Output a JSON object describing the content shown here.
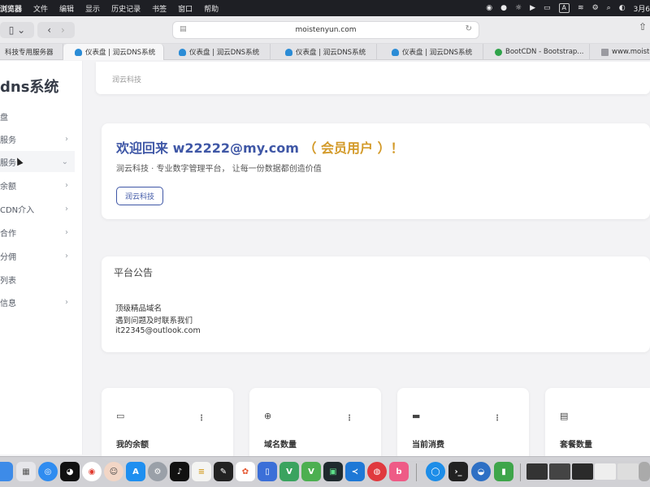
{
  "menubar": {
    "app": "浏览器",
    "items": [
      "文件",
      "编辑",
      "显示",
      "历史记录",
      "书签",
      "窗口",
      "帮助"
    ],
    "input_indicator": "A",
    "date": "3月6"
  },
  "toolbar": {
    "url": "moistenyun.com"
  },
  "tabs": [
    {
      "label": "科技专用服务器",
      "icon": "page-icon",
      "active": false
    },
    {
      "label": "仪表盘 | 润云DNS系统",
      "icon": "cloud-icon",
      "active": true
    },
    {
      "label": "仪表盘 | 润云DNS系统",
      "icon": "cloud-icon",
      "active": false
    },
    {
      "label": "仪表盘 | 润云DNS系统",
      "icon": "cloud-icon",
      "active": false
    },
    {
      "label": "仪表盘 | 润云DNS系统",
      "icon": "cloud-icon",
      "active": false
    },
    {
      "label": "BootCDN - Bootstrap...",
      "icon": "bootcdn-icon",
      "active": false
    },
    {
      "label": "www.moiste",
      "icon": "page-icon",
      "active": false
    }
  ],
  "sidebar": {
    "brand": "dns系统",
    "items": [
      {
        "label": "盘",
        "chevron": ""
      },
      {
        "label": "服务",
        "chevron": "›"
      },
      {
        "label": "服务",
        "chevron": "⌄"
      },
      {
        "label": "余额",
        "chevron": "›"
      },
      {
        "label": "CDN介入",
        "chevron": "›"
      },
      {
        "label": "合作",
        "chevron": "›"
      },
      {
        "label": "分佣",
        "chevron": "›"
      },
      {
        "label": "列表",
        "chevron": ""
      },
      {
        "label": "信息",
        "chevron": "›"
      }
    ]
  },
  "breadcrumb": "润云科技",
  "welcome": {
    "greeting": "欢迎回来 w22222@my.com",
    "role": "（ 会员用户 ）！",
    "subtitle": "润云科技 · 专业数字管理平台， 让每一份数据都创造价值",
    "button": "润云科技"
  },
  "notice": {
    "title": "平台公告",
    "lines": [
      "顶级精品域名",
      "遇到问题及时联系我们",
      "it22345@outlook.com"
    ]
  },
  "stats": [
    {
      "label": "我的余额",
      "icon": "wallet-icon",
      "glyph": "▭"
    },
    {
      "label": "域名数量",
      "icon": "globe-icon",
      "glyph": "⊕"
    },
    {
      "label": "当前消费",
      "icon": "credit-card-icon",
      "glyph": "▬"
    },
    {
      "label": "套餐数量",
      "icon": "package-icon",
      "glyph": "▤"
    }
  ],
  "colors": {
    "primary": "#3f57a6",
    "vip": "#d39a29"
  }
}
